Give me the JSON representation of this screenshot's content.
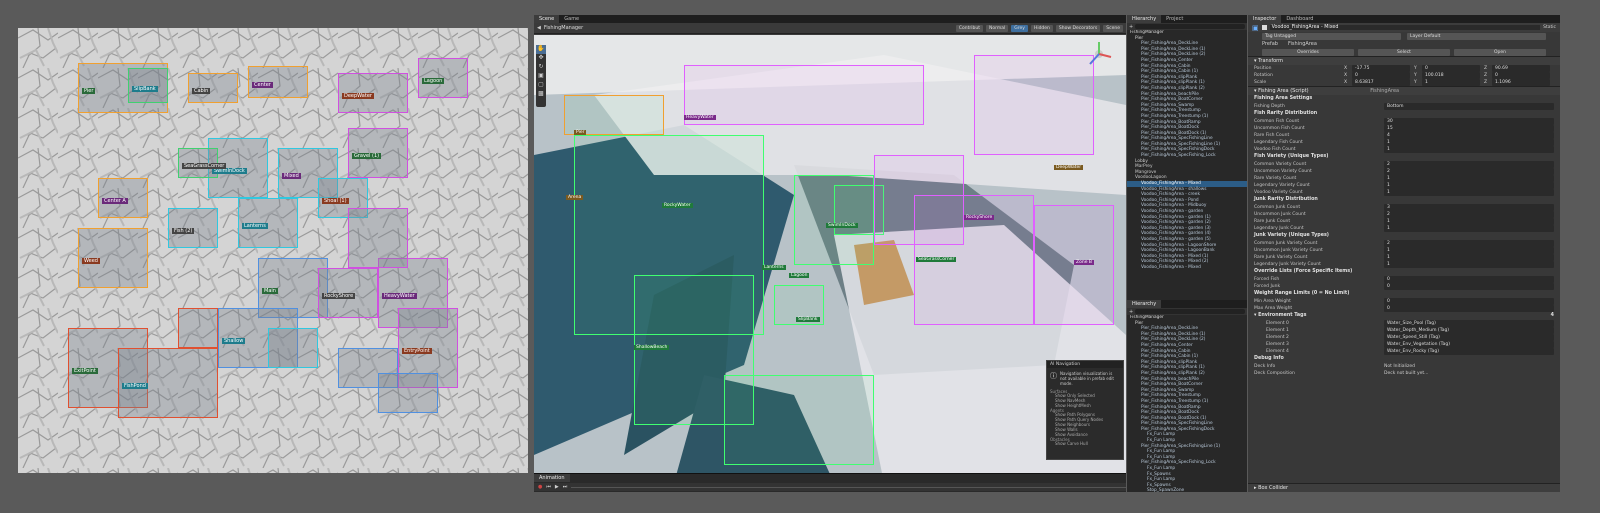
{
  "editor": {
    "tabs": [
      "Scene",
      "Game"
    ],
    "breadcrumb": "FishingManager",
    "toolbar": {
      "pivot": "Center",
      "space": "Global",
      "mode": "2D",
      "contrib": "Contribut",
      "normal": "Normal",
      "grey": "Grey",
      "hidden": "Hidden",
      "show_decorators": "Show Decorators",
      "scene_btn": "Scene"
    },
    "bottom_tab": "Animation",
    "navigation": {
      "title": "AI Navigation",
      "message": "Navigation visualization is not available in prefab edit mode.",
      "surfaces_label": "Surfaces",
      "surfaces": [
        "Show Only Selected",
        "Show NavMesh",
        "Show HeightMesh"
      ],
      "agents_label": "Agents",
      "agents": [
        "Show Path Polygons",
        "Show Path Query Nodes",
        "Show Neighbours",
        "Show Walls",
        "Show Avoidance"
      ],
      "obstacles_label": "Obstacles",
      "obstacles": [
        "Show Carve Hull"
      ]
    },
    "scene_labels": [
      "RockyWater",
      "SwimInDock",
      "Lanterns",
      "Lagoon",
      "SeaGrassCorner",
      "ShallowBeach",
      "SlipBank",
      "HeavyWater",
      "Zone B",
      "RockyShore",
      "Arena",
      "DeepWater",
      "Pier"
    ]
  },
  "overview_labels": [
    "Pier",
    "SlipBank",
    "Cabin",
    "Center",
    "DeepWater",
    "Lagoon",
    "SwimInDock",
    "SeaGrassCorner",
    "Mixed",
    "Shoal (1)",
    "Gravel (1)",
    "Lanterns",
    "Fish (2)",
    "Center A",
    "Weed",
    "Main",
    "Shallow",
    "RockyShore",
    "HeavyWater",
    "EntryPoint",
    "ExitPoint",
    "FishPond"
  ],
  "hierarchy": {
    "tabs": [
      "Hierarchy",
      "Project"
    ],
    "top": {
      "root": "FishingManager",
      "group": "Pier",
      "items": [
        "Pier_FishingArea_DeckLine",
        "Pier_FishingArea_DeckLine (1)",
        "Pier_FishingArea_DeckLine (2)",
        "Pier_FishingArea_Center",
        "Pier_FishingArea_Cabin",
        "Pier_FishingArea_Cabin (1)",
        "Pier_FishingArea_slipPlank",
        "Pier_FishingArea_slipPlank (1)",
        "Pier_FishingArea_slipPlank (2)",
        "Pier_FishingArea_beachPile",
        "Pier_FishingArea_BoatCorner",
        "Pier_FishingArea_Swamp",
        "Pier_FishingArea_Treestump",
        "Pier_FishingArea_Treestump (1)",
        "Pier_FishingArea_BoatRamp",
        "Pier_FishingArea_BoatDock",
        "Pier_FishingArea_BoatDock (1)",
        "Pier_FishingArea_SpecFishingLine",
        "Pier_FishingArea_SpecFishingLine (1)",
        "Pier_FishingArea_SpecFishingDock",
        "Pier_FishingArea_SpecFishing_Lock"
      ],
      "groups": [
        "Lobby",
        "MarPrey",
        "Mangrove",
        "VoodooLagoon"
      ],
      "voodoo": [
        "Voodoo_FishingArea - Mixed",
        "Voodoo_FishingArea - shallows",
        "Voodoo_FishingArea - creek",
        "Voodoo_FishingArea - Pond",
        "Voodoo_FishingArea - Midbuoy",
        "Voodoo_FishingArea - garden",
        "Voodoo_FishingArea - garden (1)",
        "Voodoo_FishingArea - garden (2)",
        "Voodoo_FishingArea - garden (3)",
        "Voodoo_FishingArea - garden (4)",
        "Voodoo_FishingArea - garden (5)",
        "Voodoo_FishingArea - LagoonShore",
        "Voodoo_FishingArea - LagoonBank",
        "Voodoo_FishingArea - Mixed (1)",
        "Voodoo_FishingArea - Mixed (2)",
        "Voodoo_FishingArea - Mixed"
      ],
      "selected": "Voodoo_FishingArea - Mixed"
    },
    "bottom": {
      "tab": "Hierarchy",
      "root": "FishingManager",
      "group": "Pier",
      "items": [
        "Pier_FishingArea_DeckLine",
        "Pier_FishingArea_DeckLine (1)",
        "Pier_FishingArea_DeckLine (2)",
        "Pier_FishingArea_Center",
        "Pier_FishingArea_Cabin",
        "Pier_FishingArea_Cabin (1)",
        "Pier_FishingArea_slipPlank",
        "Pier_FishingArea_slipPlank (1)",
        "Pier_FishingArea_slipPlank (2)",
        "Pier_FishingArea_beachPile",
        "Pier_FishingArea_BoatCorner",
        "Pier_FishingArea_Swamp",
        "Pier_FishingArea_Treestump",
        "Pier_FishingArea_Treestump (1)",
        "Pier_FishingArea_BoatRamp",
        "Pier_FishingArea_BoatDock",
        "Pier_FishingArea_BoatDock (1)",
        "Pier_FishingArea_SpecFishingLine",
        "Pier_FishingArea_SpecFishingDock",
        "Fx_Fun Lamp",
        "Fx_Fun Lamp",
        "Pier_FishingArea_SpecFishingLine (1)",
        "Fx_Fun Lamp",
        "Fx_Fun Lamp",
        "Pier_FishingArea_SpecFishing_Lock",
        "Fx_Fun Lamp",
        "Fx_Spawns",
        "Fx_Fun Lamp",
        "Fx_Spawns",
        "Stop_SpawnZone"
      ]
    }
  },
  "inspector": {
    "tabs": [
      "Inspector",
      "Dashboard"
    ],
    "object_name": "Voodoo_FishingArea - Mixed",
    "static_label": "Static",
    "tag": "Tag  Untagged",
    "layer": "Layer  Default",
    "prefab_label": "Prefab",
    "prefab_name": "FishingArea",
    "overrides": "Overrides",
    "select": "Select",
    "open": "Open",
    "transform": {
      "title": "Transform",
      "rows": [
        {
          "label": "Position",
          "x": "-17.75",
          "y": "0",
          "z": "90.69"
        },
        {
          "label": "Rotation",
          "x": "0",
          "y": "100.018",
          "z": "0"
        },
        {
          "label": "Scale",
          "x": "8.63817",
          "y": "1",
          "z": "1.1096"
        }
      ]
    },
    "script_title": "Fishing Area (Script)",
    "script_ref": "FishingArea",
    "sections": [
      {
        "title": "Fishing Area Settings",
        "rows": [
          {
            "k": "Fishing Depth",
            "v": "Bottom"
          }
        ]
      },
      {
        "title": "Fish Rarity Distribution",
        "rows": [
          {
            "k": "Common Fish Count",
            "v": "30"
          },
          {
            "k": "Uncommon Fish Count",
            "v": "15"
          },
          {
            "k": "Rare Fish Count",
            "v": "4"
          },
          {
            "k": "Legendary Fish Count",
            "v": "1"
          },
          {
            "k": "Voodoo Fish Count",
            "v": "1"
          }
        ]
      },
      {
        "title": "Fish Variety (Unique Types)",
        "rows": [
          {
            "k": "Common Variety Count",
            "v": "2"
          },
          {
            "k": "Uncommon Variety Count",
            "v": "2"
          },
          {
            "k": "Rare Variety Count",
            "v": "1"
          },
          {
            "k": "Legendary Variety Count",
            "v": "1"
          },
          {
            "k": "Voodoo Variety Count",
            "v": "1"
          }
        ]
      },
      {
        "title": "Junk Rarity Distribution",
        "rows": [
          {
            "k": "Common Junk Count",
            "v": "3"
          },
          {
            "k": "Uncommon Junk Count",
            "v": "2"
          },
          {
            "k": "Rare Junk Count",
            "v": "1"
          },
          {
            "k": "Legendary Junk Count",
            "v": "1"
          }
        ]
      },
      {
        "title": "Junk Variety (Unique Types)",
        "rows": [
          {
            "k": "Common Junk Variety Count",
            "v": "2"
          },
          {
            "k": "Uncommon Junk Variety Count",
            "v": "1"
          },
          {
            "k": "Rare Junk Variety Count",
            "v": "1"
          },
          {
            "k": "Legendary Junk Variety Count",
            "v": "1"
          }
        ]
      },
      {
        "title": "Override Lists (Force Specific Items)",
        "rows": [
          {
            "k": "Forced Fish",
            "v": "0"
          },
          {
            "k": "Forced Junk",
            "v": "0"
          }
        ]
      },
      {
        "title": "Weight Range Limits (0 = No Limit)",
        "rows": [
          {
            "k": "Min Area Weight",
            "v": "0"
          },
          {
            "k": "Max Area Weight",
            "v": "0"
          }
        ]
      }
    ],
    "env_tags_label": "Environment Tags",
    "env_tags_count": "4",
    "env_tags": [
      {
        "k": "Element 0",
        "v": "Water_Size_Pool (Tag)"
      },
      {
        "k": "Element 1",
        "v": "Water_Depth_Medium (Tag)"
      },
      {
        "k": "Element 2",
        "v": "Water_Speed_Still (Tag)"
      },
      {
        "k": "Element 3",
        "v": "Water_Env_Vegetation (Tag)"
      },
      {
        "k": "Element 4",
        "v": "Water_Env_Rocky (Tag)"
      }
    ],
    "debug_title": "Debug Info",
    "debug_rows": [
      {
        "k": "Deck Info",
        "v": "Not Initialized"
      },
      {
        "k": "Deck Composition",
        "v": "Deck not built yet..."
      }
    ],
    "footer_component": "Box Collider"
  }
}
